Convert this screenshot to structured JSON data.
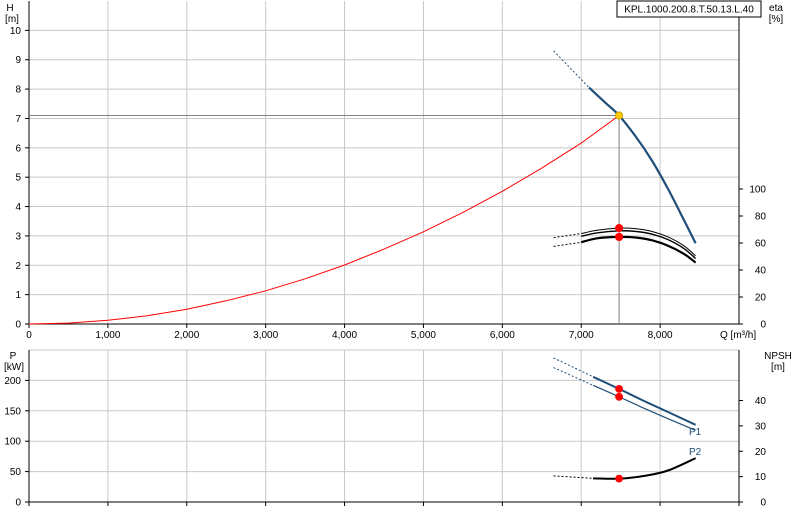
{
  "chart_data": [
    {
      "type": "line",
      "name": "head-chart",
      "model_label": "KPL.1000.200.8.T.50.13.L.40",
      "y_left_label": [
        "H",
        "[m]"
      ],
      "y_right_label": [
        "eta",
        "[%]"
      ],
      "xlabel": "Q [m³/h]",
      "xlim": [
        0,
        9000
      ],
      "ylim_left": [
        0,
        11
      ],
      "ylim_right": [
        0,
        100
      ],
      "x_ticks": [
        0,
        1000,
        2000,
        3000,
        4000,
        5000,
        6000,
        7000,
        8000
      ],
      "x_tick_labels": [
        "0",
        "1,000",
        "2,000",
        "3,000",
        "4,000",
        "5,000",
        "6,000",
        "7,000",
        "8,000"
      ],
      "y_left_ticks": [
        0,
        1,
        2,
        3,
        4,
        5,
        6,
        7,
        8,
        9,
        10
      ],
      "y_right_ticks": [
        0,
        20,
        40,
        60,
        80,
        100
      ],
      "grid": true,
      "operating_point": {
        "q": 7480,
        "h": 7.1
      },
      "series": [
        {
          "role": "system-curve",
          "color": "#ff0000",
          "points": [
            [
              0,
              0
            ],
            [
              500,
              0.03
            ],
            [
              1000,
              0.13
            ],
            [
              1500,
              0.28
            ],
            [
              2000,
              0.5
            ],
            [
              2500,
              0.79
            ],
            [
              3000,
              1.13
            ],
            [
              3500,
              1.54
            ],
            [
              4000,
              2.01
            ],
            [
              4500,
              2.55
            ],
            [
              5000,
              3.14
            ],
            [
              5500,
              3.8
            ],
            [
              6000,
              4.52
            ],
            [
              6500,
              5.31
            ],
            [
              7000,
              6.16
            ],
            [
              7480,
              7.1
            ]
          ]
        },
        {
          "role": "pump-head",
          "color": "#1f4e79",
          "dashed": [
            [
              6650,
              9.3
            ],
            [
              7100,
              8.05
            ]
          ],
          "points": [
            [
              7100,
              8.05
            ],
            [
              7300,
              7.55
            ],
            [
              7480,
              7.1
            ],
            [
              7700,
              6.35
            ],
            [
              7900,
              5.55
            ],
            [
              8100,
              4.6
            ],
            [
              8300,
              3.55
            ],
            [
              8450,
              2.75
            ]
          ]
        },
        {
          "role": "efficiency-1",
          "color": "#000000",
          "dashed": [
            [
              6650,
              64
            ],
            [
              7000,
              67
            ]
          ],
          "points": [
            [
              7000,
              67
            ],
            [
              7200,
              69.5
            ],
            [
              7480,
              71
            ],
            [
              7700,
              70.5
            ],
            [
              7900,
              68.5
            ],
            [
              8100,
              64.5
            ],
            [
              8300,
              58
            ],
            [
              8450,
              50.5
            ]
          ]
        },
        {
          "role": "efficiency-2",
          "color": "#000000",
          "dashed": [
            [
              6650,
              57.5
            ],
            [
              7000,
              60.5
            ]
          ],
          "points": [
            [
              7000,
              60.5
            ],
            [
              7200,
              63.5
            ],
            [
              7480,
              64.5
            ],
            [
              7700,
              64
            ],
            [
              7900,
              62
            ],
            [
              8100,
              58
            ],
            [
              8300,
              52
            ],
            [
              8450,
              45.5
            ]
          ]
        }
      ],
      "markers": [
        {
          "x": 7480,
          "y": 7.1,
          "axis": "left",
          "color": "#ffc800"
        },
        {
          "x": 7480,
          "y": 71,
          "axis": "right",
          "color": "#ff0000"
        },
        {
          "x": 7480,
          "y": 64.5,
          "axis": "right",
          "color": "#ff0000"
        }
      ]
    },
    {
      "type": "line",
      "name": "power-npsh-chart",
      "y_left_label": [
        "P",
        "[kW]"
      ],
      "y_right_label": [
        "NPSH",
        "[m]"
      ],
      "xlim": [
        0,
        9000
      ],
      "ylim_left": [
        0,
        250
      ],
      "ylim_right": [
        0,
        50
      ],
      "y_left_ticks": [
        0,
        50,
        100,
        150,
        200
      ],
      "y_right_ticks": [
        0,
        10,
        20,
        30,
        40
      ],
      "grid": true,
      "series": [
        {
          "name": "P1",
          "color": "#1f4e79",
          "dashed": [
            [
              6650,
              237
            ],
            [
              7150,
              206
            ]
          ],
          "points": [
            [
              7150,
              206
            ],
            [
              7480,
              186
            ],
            [
              7800,
              166
            ],
            [
              8100,
              148
            ],
            [
              8450,
              127
            ]
          ]
        },
        {
          "name": "P2",
          "color": "#1f4e79",
          "dashed": [
            [
              6650,
              221
            ],
            [
              7150,
              192
            ]
          ],
          "points": [
            [
              7150,
              192
            ],
            [
              7480,
              173
            ],
            [
              7800,
              154
            ],
            [
              8100,
              137
            ],
            [
              8450,
              118
            ]
          ]
        },
        {
          "role": "npsh",
          "color": "#000000",
          "dashed": [
            [
              6650,
              10.3
            ],
            [
              7150,
              9.3
            ]
          ],
          "points": [
            [
              7150,
              9.3
            ],
            [
              7480,
              9.2
            ],
            [
              7800,
              10.3
            ],
            [
              8100,
              12.4
            ],
            [
              8450,
              17.3
            ]
          ]
        }
      ],
      "markers": [
        {
          "x": 7480,
          "y": 186,
          "axis": "left",
          "color": "#ff0000"
        },
        {
          "x": 7480,
          "y": 173,
          "axis": "left",
          "color": "#ff0000"
        },
        {
          "x": 7480,
          "y": 9.2,
          "axis": "right",
          "color": "#ff0000"
        }
      ]
    }
  ]
}
